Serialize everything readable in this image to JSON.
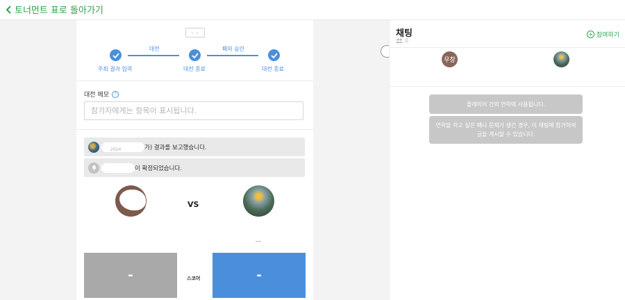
{
  "header": {
    "back_label": "토너먼트 표로 돌아가기"
  },
  "match": {
    "options_label": "- -",
    "stepper": {
      "connectors": [
        "대전",
        "패자 승인"
      ],
      "steps": [
        "주최 결과 입력",
        "대전 종료",
        "대전 종료"
      ]
    },
    "memo": {
      "label": "대전 메모",
      "placeholder": "참가자에게는 항목이 표시됩니다."
    },
    "log": [
      {
        "text": "가) 결과를 보고했습니다.",
        "sub": "2024"
      },
      {
        "text": "이 확정되었습니다."
      }
    ],
    "vs_label": "VS",
    "score": {
      "left": "-",
      "label": "스코어",
      "right": "-"
    },
    "colors": {
      "left_box": "#a9a9a9",
      "right_box": "#4a8fdc",
      "accent": "#4a8fdc"
    }
  },
  "chat": {
    "title": "채팅",
    "member_count": "0",
    "join_label": "참여하기",
    "avatars": [
      {
        "initials": "우창",
        "color": "#8a6658"
      }
    ],
    "notices": [
      "플레이어 간의 연락에 사용됩니다.",
      "연락을 하고 싶은 때나 문제가 생긴 경우, 이 채팅에 참가하여 글을 게시할 수 있습니다."
    ]
  },
  "icons": [
    "chevron-left-icon",
    "check-icon",
    "help-icon",
    "people-icon",
    "plus-circle-icon"
  ]
}
